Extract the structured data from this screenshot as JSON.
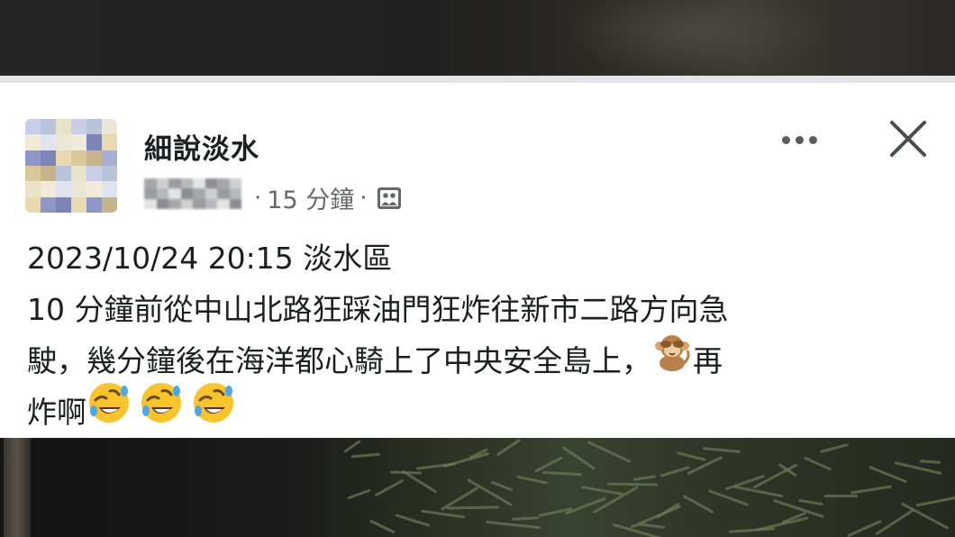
{
  "post": {
    "page_name": "細說淡水",
    "time_ago": "15 分鐘",
    "separator": "·",
    "audience_icon": "public-group-icon",
    "lines": [
      "2023/10/24  20:15 淡水區",
      "10 分鐘前從中山北路狂踩油門狂炸往新市二路方向急",
      "駛，幾分鐘後在海洋都心騎上了中央安全島上，",
      "再",
      "炸啊"
    ],
    "emojis": {
      "monkey": "see-no-evil-monkey-emoji",
      "laugh": "rolling-on-floor-laughing-emoji"
    }
  },
  "actions": {
    "more_icon": "more-options-icon",
    "close_icon": "close-icon"
  },
  "colors": {
    "text_primary": "#1c1e21",
    "text_secondary": "#65676b",
    "card_bg": "#ffffff"
  }
}
